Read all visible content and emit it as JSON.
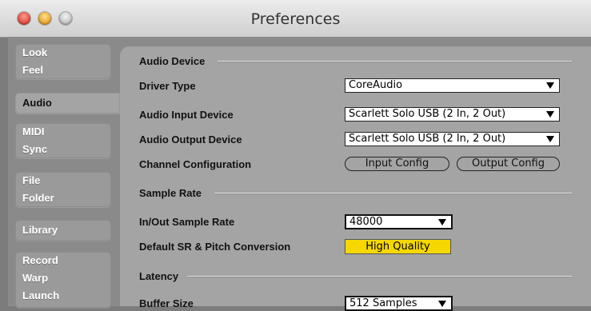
{
  "window": {
    "title": "Preferences"
  },
  "sidebar": {
    "tabs": [
      {
        "lines": [
          "Look",
          "Feel"
        ],
        "active": false
      },
      {
        "lines": [
          "Audio"
        ],
        "active": true
      },
      {
        "lines": [
          "MIDI",
          "Sync"
        ],
        "active": false
      },
      {
        "lines": [
          "File",
          "Folder"
        ],
        "active": false
      },
      {
        "lines": [
          "Library"
        ],
        "active": false
      },
      {
        "lines": [
          "Record",
          "Warp",
          "Launch"
        ],
        "active": false
      }
    ]
  },
  "audio_device": {
    "section_title": "Audio Device",
    "driver_type": {
      "label": "Driver Type",
      "value": "CoreAudio"
    },
    "input_device": {
      "label": "Audio Input Device",
      "value": "Scarlett Solo USB (2 In, 2 Out)"
    },
    "output_device": {
      "label": "Audio Output Device",
      "value": "Scarlett Solo USB (2 In, 2 Out)"
    },
    "channel_config": {
      "label": "Channel Configuration",
      "input_button": "Input Config",
      "output_button": "Output Config"
    }
  },
  "sample_rate": {
    "section_title": "Sample Rate",
    "in_out": {
      "label": "In/Out Sample Rate",
      "value": "48000"
    },
    "conversion": {
      "label": "Default SR & Pitch Conversion",
      "value": "High Quality"
    }
  },
  "latency": {
    "section_title": "Latency",
    "buffer_size": {
      "label": "Buffer Size",
      "value": "512 Samples"
    }
  },
  "colors": {
    "highlight": "#f6d800",
    "panel": "#a4a4a4",
    "background": "#8a8a8a"
  }
}
